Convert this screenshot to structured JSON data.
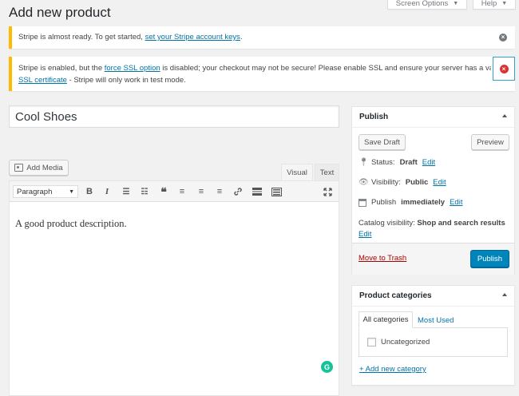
{
  "page": {
    "title": "Add new product"
  },
  "top_buttons": {
    "screen_options": "Screen Options",
    "help": "Help"
  },
  "notices": {
    "stripe_ready": {
      "text": "Stripe is almost ready. To get started,",
      "link": "set your Stripe account keys",
      "suffix": "."
    },
    "ssl": {
      "text1": "Stripe is enabled, but the",
      "link1": "force SSL option",
      "text2": "is disabled; your checkout may not be secure! Please enable SSL and ensure your server has a valid",
      "link2": "SSL certificate",
      "text3": "- Stripe will only work in test mode."
    }
  },
  "product": {
    "title": "Cool Shoes"
  },
  "editor": {
    "add_media": "Add Media",
    "tab_visual": "Visual",
    "tab_text": "Text",
    "format_select": "Paragraph",
    "content": "A good product description.",
    "grammarly": "G"
  },
  "publish": {
    "heading": "Publish",
    "save_draft": "Save Draft",
    "preview": "Preview",
    "status_label": "Status:",
    "status_value": "Draft",
    "visibility_label": "Visibility:",
    "visibility_value": "Public",
    "publish_label": "Publish",
    "publish_value": "immediately",
    "catalog_label": "Catalog visibility:",
    "catalog_value": "Shop and search results",
    "edit": "Edit",
    "trash": "Move to Trash",
    "publish_button": "Publish"
  },
  "categories": {
    "heading": "Product categories",
    "tab_all": "All categories",
    "tab_used": "Most Used",
    "items": [
      {
        "label": "Uncategorized",
        "checked": false
      }
    ],
    "add_new": "+ Add new category"
  },
  "colors": {
    "accent": "#0073aa",
    "primary_button": "#0085ba",
    "notice_warning": "#ffb900",
    "error": "#dc3232"
  }
}
